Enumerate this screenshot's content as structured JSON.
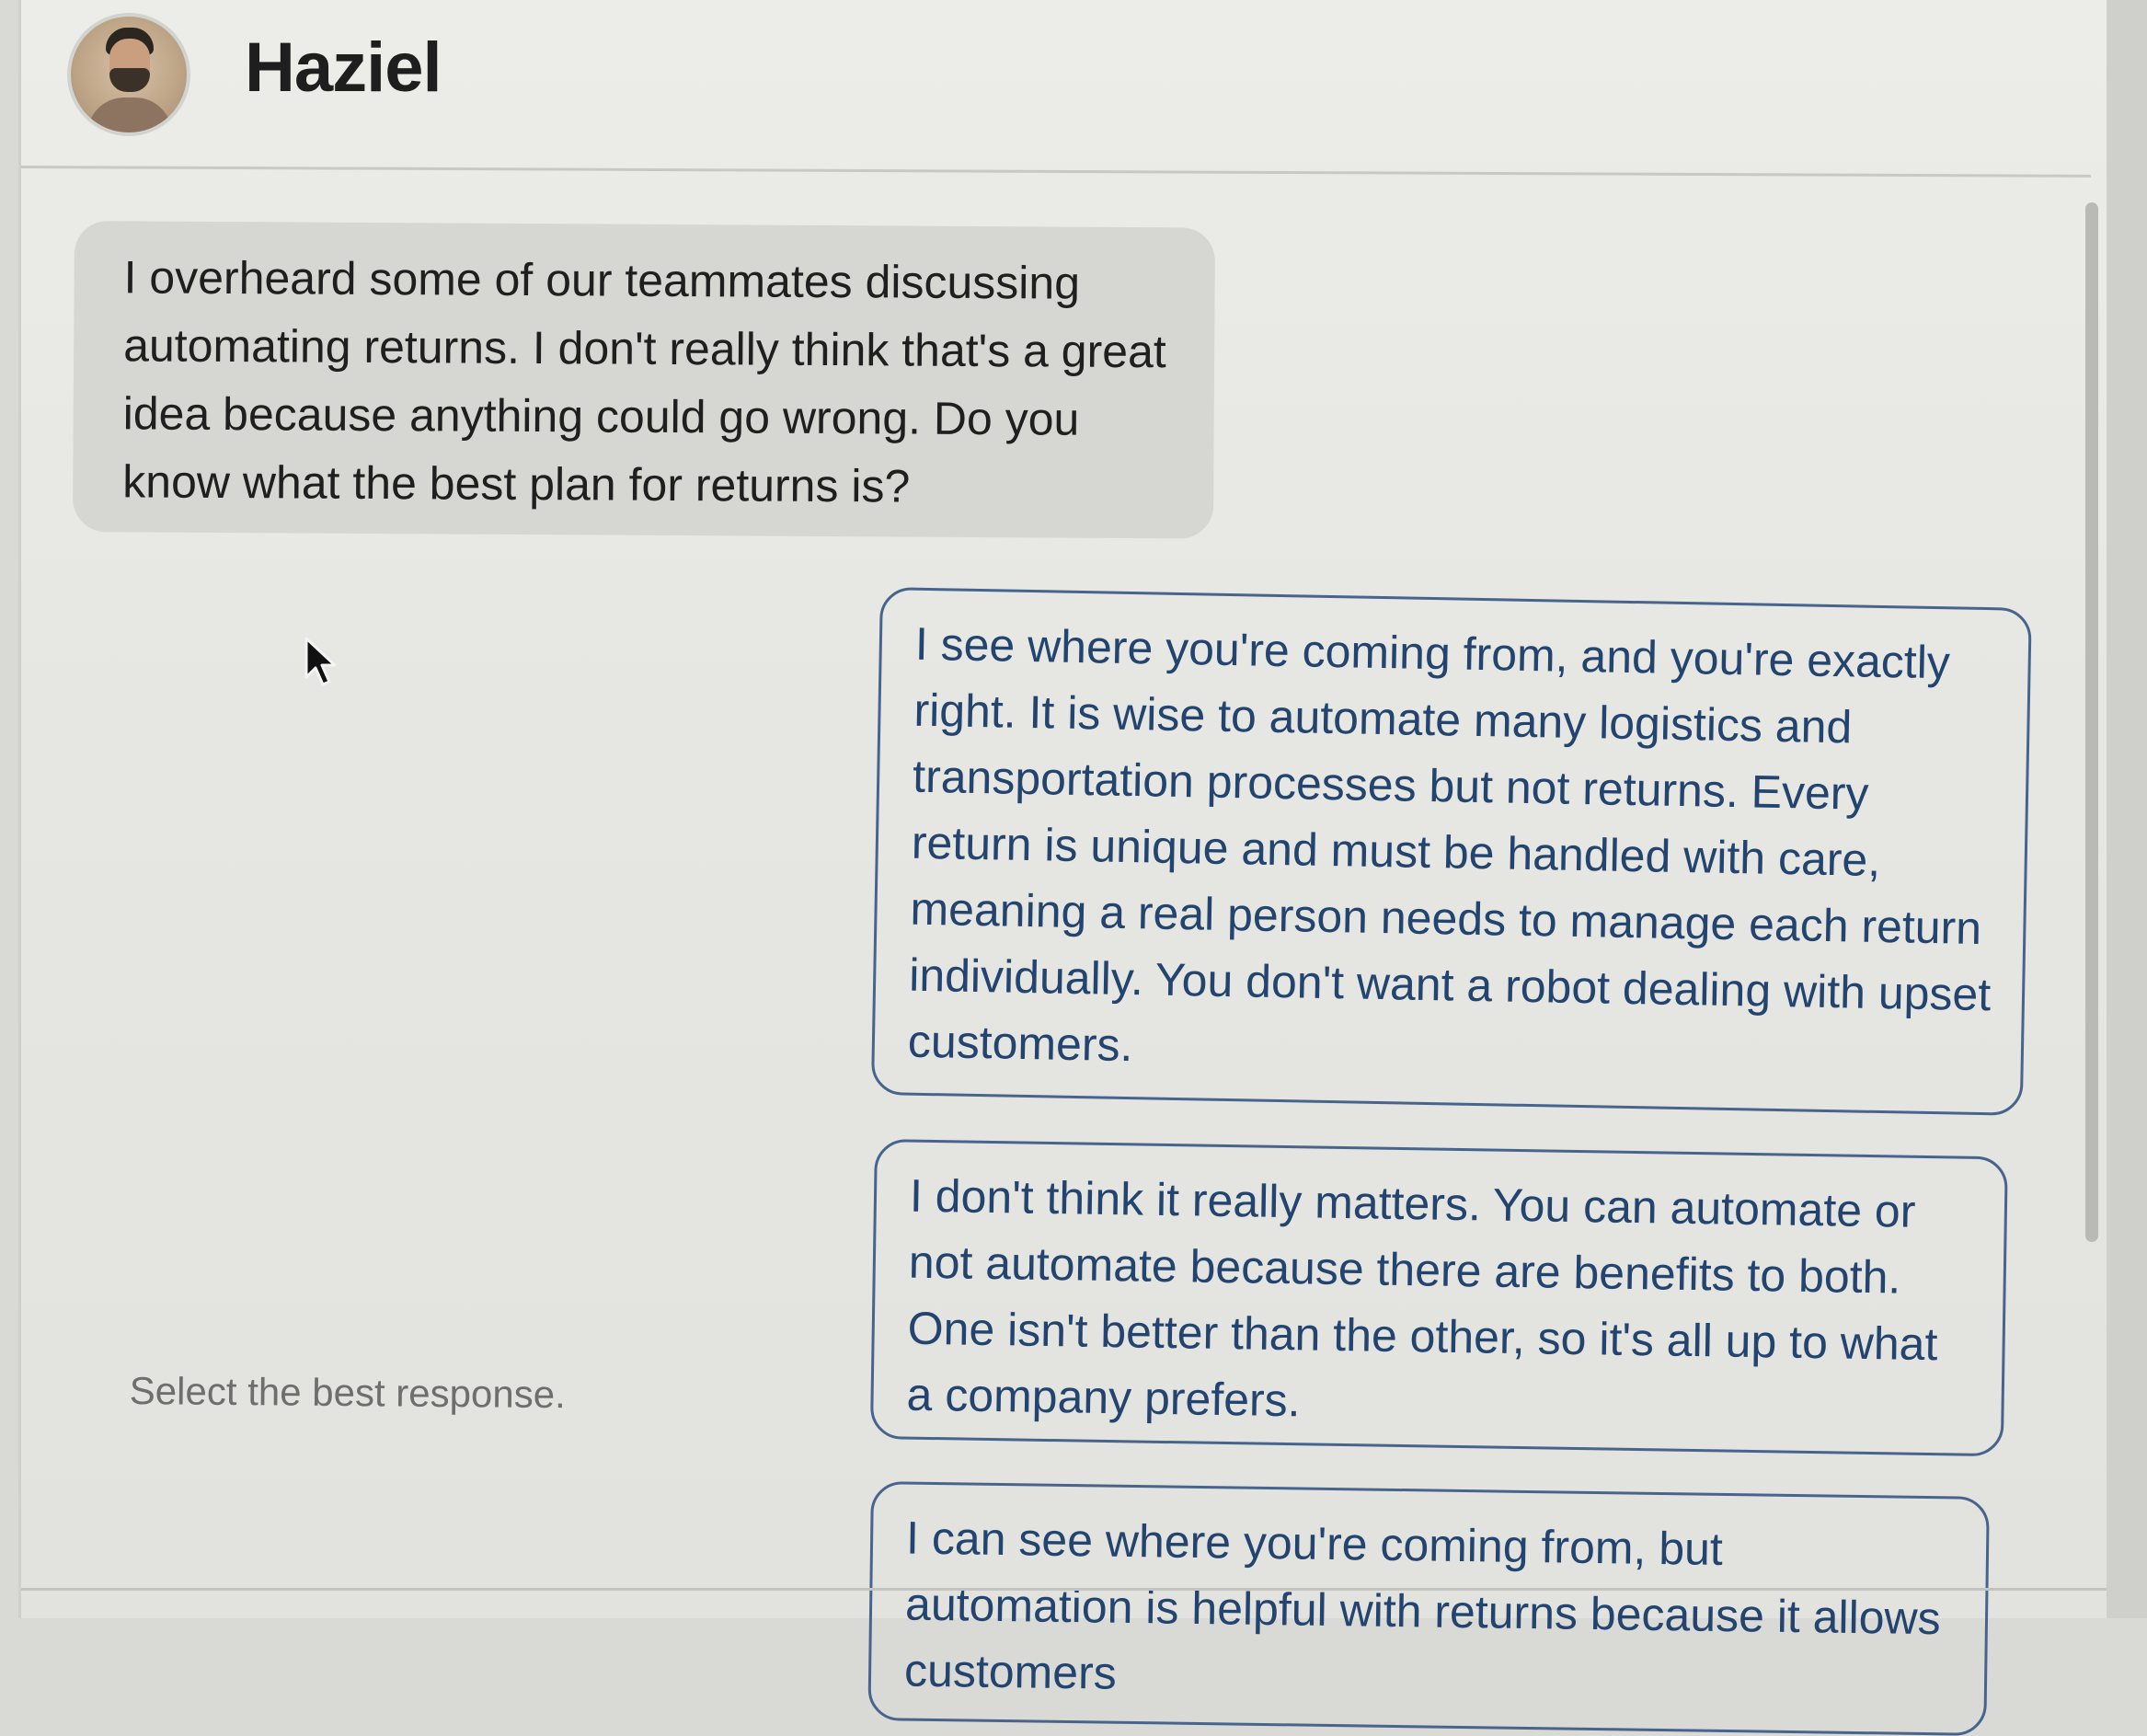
{
  "header": {
    "name": "Haziel",
    "avatar_icon": "person-avatar"
  },
  "question": {
    "text": "I overheard some of our teammates discussing automating returns. I don't really think that's a great idea because anything could go wrong. Do you know what the best plan for returns is?"
  },
  "prompt": {
    "text": "Select the best response."
  },
  "options": [
    {
      "text": "I see where you're coming from, and you're exactly right. It is wise to automate many logistics and transportation processes but not returns. Every return is unique and must be handled with care, meaning a real person needs to manage each return individually. You don't want a robot dealing with upset customers."
    },
    {
      "text": "I don't think it really matters. You can automate or not automate because there are benefits to both. One isn't better than the other, so it's all up to what a company prefers."
    },
    {
      "text": "I can see where you're coming from, but automation is helpful with returns because it allows customers"
    }
  ],
  "colors": {
    "option_border": "#47648c",
    "option_text": "#23446f",
    "question_bubble": "#d6d6d3",
    "page_background": "#e8e8e4"
  }
}
